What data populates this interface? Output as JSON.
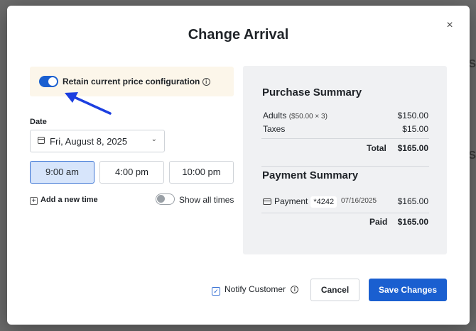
{
  "modal": {
    "title": "Change Arrival",
    "close_glyph": "×"
  },
  "retain": {
    "label": "Retain current price configuration",
    "toggle_on": true
  },
  "date": {
    "label": "Date",
    "value": "Fri, August 8, 2025"
  },
  "times": [
    {
      "label": "9:00 am",
      "selected": true
    },
    {
      "label": "4:00 pm",
      "selected": false
    },
    {
      "label": "10:00 pm",
      "selected": false
    }
  ],
  "add_time": {
    "label": "Add a new time"
  },
  "show_all": {
    "label": "Show all times",
    "toggle_on": false
  },
  "purchase_summary": {
    "title": "Purchase Summary",
    "adults_label": "Adults",
    "adults_detail": "($50.00 × 3)",
    "adults_amount": "$150.00",
    "taxes_label": "Taxes",
    "taxes_amount": "$15.00",
    "total_label": "Total",
    "total_amount": "$165.00"
  },
  "payment_summary": {
    "title": "Payment Summary",
    "payment_label": "Payment",
    "card_last4": "*4242",
    "payment_date": "07/16/2025",
    "payment_amount": "$165.00",
    "paid_label": "Paid",
    "paid_amount": "$165.00"
  },
  "footer": {
    "notify_label": "Notify Customer",
    "notify_checked": true,
    "cancel_label": "Cancel",
    "save_label": "Save Changes"
  },
  "colors": {
    "primary": "#1a5fd0",
    "highlight_bg": "#fcf6ea",
    "summary_bg": "#f0f1f3",
    "arrow": "#1c3fe0"
  }
}
